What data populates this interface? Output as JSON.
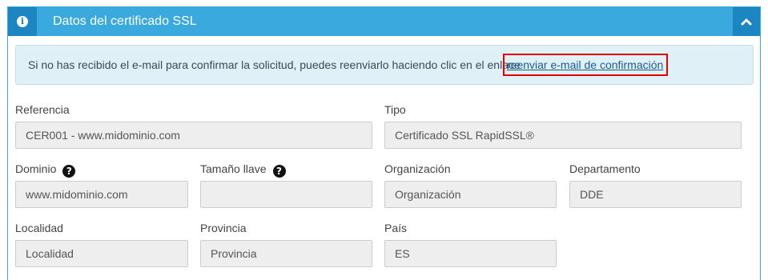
{
  "header": {
    "title": "Datos del certificado SSL",
    "info_icon_glyph": "i",
    "collapse_icon": "chevron-up-icon"
  },
  "alert": {
    "text": "Si no has recibido el e-mail para confirmar la solicitud, puedes reenviarlo haciendo clic en el enlace",
    "link_text": "reenviar e-mail de confirmación"
  },
  "fields": {
    "referencia": {
      "label": "Referencia",
      "value": "CER001 - www.midominio.com"
    },
    "tipo": {
      "label": "Tipo",
      "value": "Certificado SSL RapidSSL®"
    },
    "dominio": {
      "label": "Dominio",
      "value": "www.midominio.com"
    },
    "tamano_llave": {
      "label": "Tamaño llave",
      "value": ""
    },
    "organizacion": {
      "label": "Organización",
      "value": "Organización"
    },
    "departamento": {
      "label": "Departamento",
      "value": "DDE"
    },
    "localidad": {
      "label": "Localidad",
      "value": "Localidad"
    },
    "provincia": {
      "label": "Provincia",
      "value": "Provincia"
    },
    "pais": {
      "label": "País",
      "value": "ES"
    }
  },
  "help_glyph": "?",
  "colors": {
    "header_bg": "#3aa9de",
    "header_dark": "#1c85c2",
    "alert_bg": "#dff0f7",
    "highlight_border": "#e00000",
    "field_bg": "#eeeeee"
  }
}
